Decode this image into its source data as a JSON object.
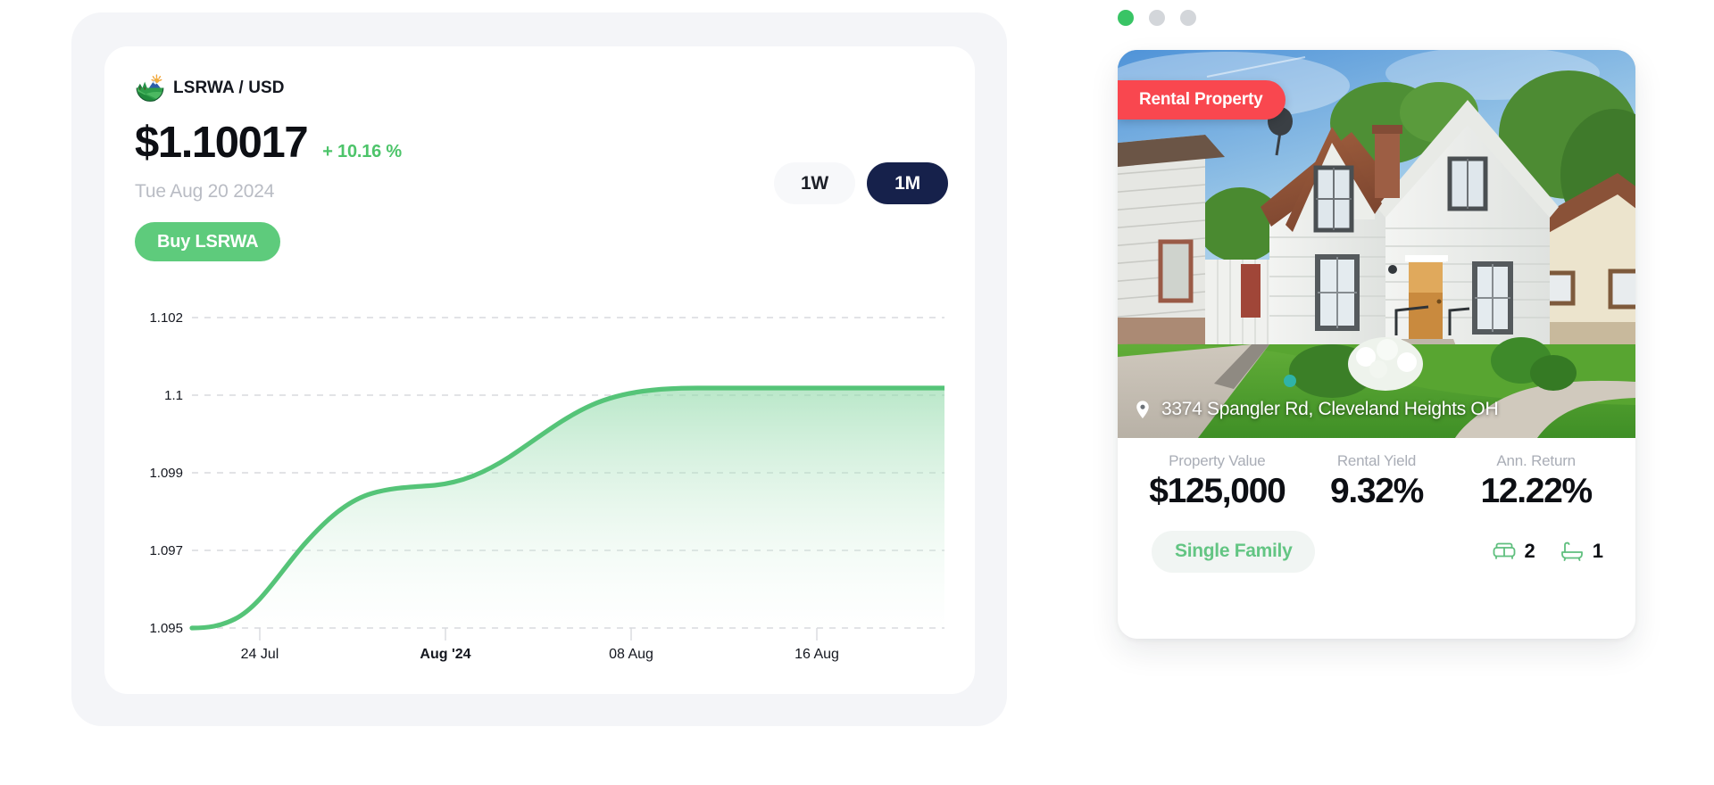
{
  "token_panel": {
    "pair_name": "LSRWA / USD",
    "logo_icon": "landscape-hills-sun-logo",
    "price": "$1.10017",
    "change": "+ 10.16 %",
    "change_color": "#4dc46a",
    "date": "Tue Aug 20 2024",
    "buy_button": "Buy LSRWA",
    "ranges": [
      {
        "label": "1W",
        "active": false
      },
      {
        "label": "1M",
        "active": true
      }
    ],
    "active_range_color": "#16214b"
  },
  "chart_data": {
    "type": "area",
    "title": "LSRWA / USD price",
    "xlabel": "",
    "ylabel": "",
    "grid": true,
    "legend": false,
    "line_color": "#4dc46a",
    "fill_color": "#c9ecd4",
    "ylim": [
      1.0946,
      1.1026
    ],
    "ytick_labels": [
      "1.102",
      "1.1",
      "1.099",
      "1.097",
      "1.095"
    ],
    "yticks": [
      1.102,
      1.1,
      1.099,
      1.097,
      1.095
    ],
    "xtick_labels": [
      "24 Jul",
      "Aug '24",
      "08 Aug",
      "16 Aug"
    ],
    "xtick_bold": [
      false,
      true,
      false,
      false
    ],
    "x": [
      "22 Jul",
      "24 Jul",
      "26 Jul",
      "28 Jul",
      "30 Jul",
      "01 Aug",
      "03 Aug",
      "05 Aug",
      "07 Aug",
      "09 Aug",
      "11 Aug",
      "13 Aug",
      "15 Aug",
      "17 Aug",
      "19 Aug",
      "20 Aug"
    ],
    "values": [
      1.095,
      1.095,
      1.0953,
      1.0962,
      1.0975,
      1.0983,
      1.0986,
      1.0986,
      1.0987,
      1.099,
      1.0994,
      1.0997,
      1.0999,
      1.1,
      1.1,
      1.1
    ]
  },
  "property_panel": {
    "carousel_dots": [
      {
        "active": true
      },
      {
        "active": false
      },
      {
        "active": false
      }
    ],
    "active_dot_color": "#39c465",
    "badge": "Rental Property",
    "badge_color": "#f9474f",
    "address": "3374 Spangler Rd, Cleveland Heights OH",
    "pin_icon": "map-pin-icon",
    "photo_alt": "white cape cod house with brown roof, front lawn and driveway",
    "stats": [
      {
        "label": "Property Value",
        "value": "$125,000"
      },
      {
        "label": "Rental Yield",
        "value": "9.32%"
      },
      {
        "label": "Ann. Return",
        "value": "12.22%"
      }
    ],
    "property_type": "Single Family",
    "property_type_color": "#63c583",
    "features": [
      {
        "icon": "bed-icon",
        "value": "2"
      },
      {
        "icon": "bath-icon",
        "value": "1"
      }
    ]
  }
}
